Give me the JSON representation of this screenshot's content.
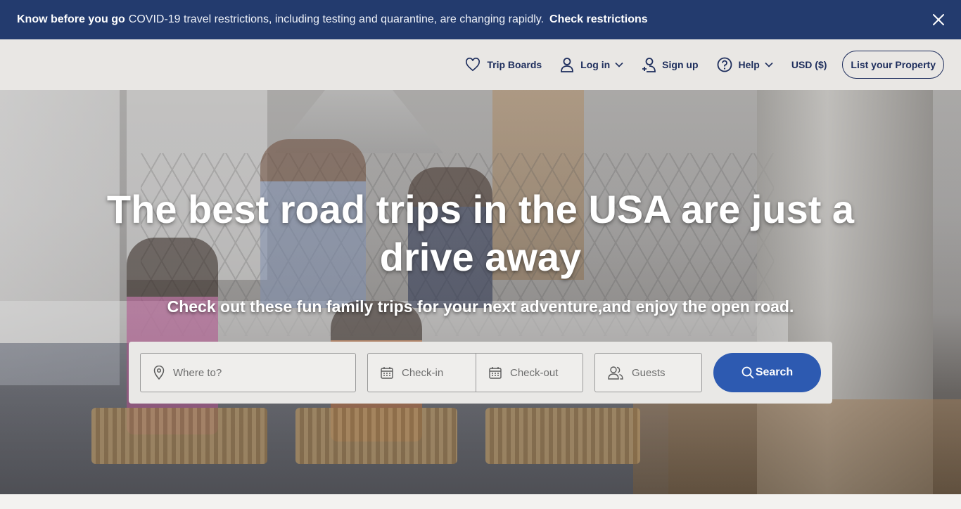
{
  "banner": {
    "bold": "Know before you go",
    "message": "COVID-19 travel restrictions, including testing and quarantine, are changing rapidly.",
    "link": "Check restrictions",
    "background": "#233b6e"
  },
  "nav": {
    "trip_boards": "Trip Boards",
    "log_in": "Log in",
    "sign_up": "Sign up",
    "help": "Help",
    "currency": "USD ($)",
    "list_property": "List your Property"
  },
  "hero": {
    "headline": "The best road trips in the USA are just a drive away",
    "subhead": "Check out these fun family trips for your next adventure,and enjoy the open road."
  },
  "search": {
    "where_placeholder": "Where to?",
    "checkin_placeholder": "Check-in",
    "checkout_placeholder": "Check-out",
    "guests_placeholder": "Guests",
    "button_label": "Search",
    "button_color": "#2d5ab1"
  },
  "icons": [
    "close-icon",
    "heart-icon",
    "user-icon",
    "chevron-down-icon",
    "user-plus-icon",
    "help-circle-icon",
    "map-pin-icon",
    "calendar-icon",
    "users-icon",
    "search-icon"
  ]
}
